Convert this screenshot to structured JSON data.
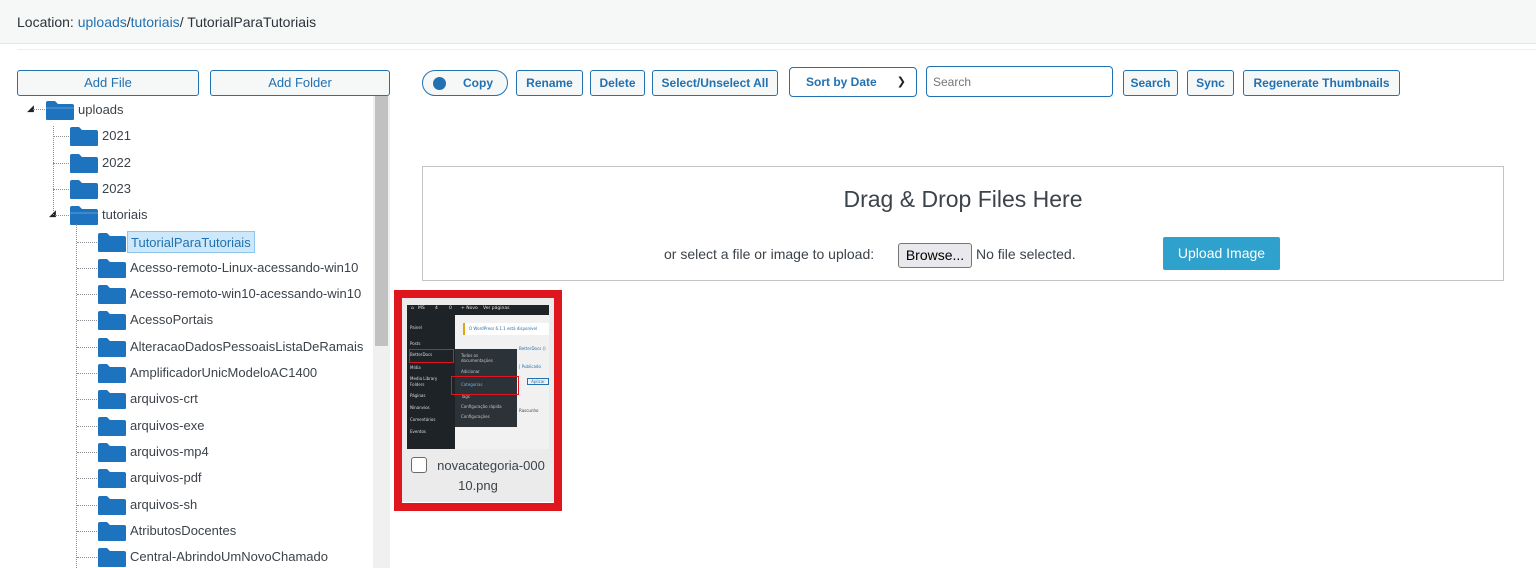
{
  "location": {
    "prefix": "Location:",
    "crumbs": [
      "uploads",
      "tutoriais"
    ],
    "separator": "/",
    "current": " TutorialParaTutoriais"
  },
  "left_panel": {
    "add_file": "Add File",
    "add_folder": "Add Folder",
    "tree": {
      "root": "uploads",
      "years": [
        "2021",
        "2022",
        "2023"
      ],
      "expanded": "tutoriais",
      "children": [
        "TutorialParaTutoriais",
        "Acesso-remoto-Linux-acessando-win10",
        "Acesso-remoto-win10-acessando-win10",
        "AcessoPortais",
        "AlteracaoDadosPessoaisListaDeRamais",
        "AmplificadorUnicModeloAC1400",
        "arquivos-crt",
        "arquivos-exe",
        "arquivos-mp4",
        "arquivos-pdf",
        "arquivos-sh",
        "AtributosDocentes",
        "Central-AbrindoUmNovoChamado"
      ],
      "selected": "TutorialParaTutoriais"
    },
    "folder_color": "#1e73be"
  },
  "toolbar": {
    "copy": "Copy",
    "rename": "Rename",
    "delete": "Delete",
    "select_all": "Select/Unselect All",
    "sort": "Sort by Date",
    "search_placeholder": "Search",
    "search": "Search",
    "sync": "Sync",
    "regenerate": "Regenerate Thumbnails"
  },
  "dropzone": {
    "title": "Drag & Drop Files Here",
    "prompt": "or select a file or image to upload:",
    "browse": "Browse...",
    "no_file": "No file selected.",
    "upload": "Upload Image"
  },
  "file": {
    "name_line1": "novacategoria-000",
    "name_line2": "10.png",
    "checked": false
  },
  "thumbnail": {
    "topbar": [
      "MS",
      "4",
      "0",
      "+ Novo",
      "Ver páginas"
    ],
    "sidebar": [
      "Painel",
      "Posts",
      "BetterDocs",
      "Mídia",
      "Media Library",
      "Folders",
      "Páginas",
      "Ninanvios",
      "Comentários",
      "Eventos"
    ],
    "submenu": [
      "Todos os",
      "documentações",
      "Adicionar",
      "Categorias",
      "Tags",
      "Configuração rápida",
      "Configurações"
    ],
    "notice": "O WordPress 6.1.1 está disponível",
    "side_text": [
      "BetterDocs ()",
      "| Publicado",
      "Aplicar",
      "Rascunho"
    ]
  },
  "colors": {
    "accent": "#2271b1",
    "highlight": "#e0161e",
    "upload_button": "#2ea2cc"
  }
}
